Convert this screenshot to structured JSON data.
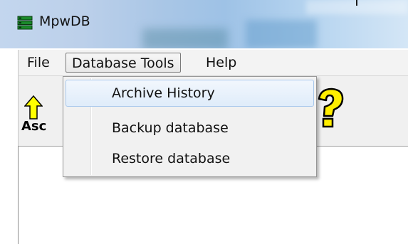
{
  "window": {
    "title": "MpwDB",
    "app_icon": "database-stack-icon"
  },
  "menubar": {
    "items": [
      {
        "label": "File"
      },
      {
        "label": "Database Tools",
        "open": true
      },
      {
        "label": "Help"
      }
    ]
  },
  "toolbar": {
    "buttons": [
      {
        "label": "Asc",
        "icon": "arrow-up-icon"
      },
      {
        "label": "",
        "icon": "help-question-icon"
      }
    ]
  },
  "dropdown": {
    "items": [
      {
        "label": "Archive History",
        "highlighted": true
      },
      {
        "label": "Backup database"
      },
      {
        "label": "Restore database"
      }
    ]
  },
  "colors": {
    "menu_highlight_border": "#a8c8ec",
    "menu_background": "#f1f1f1",
    "arrow_fill": "#ffff00",
    "help_icon_fill": "#ffee00"
  }
}
